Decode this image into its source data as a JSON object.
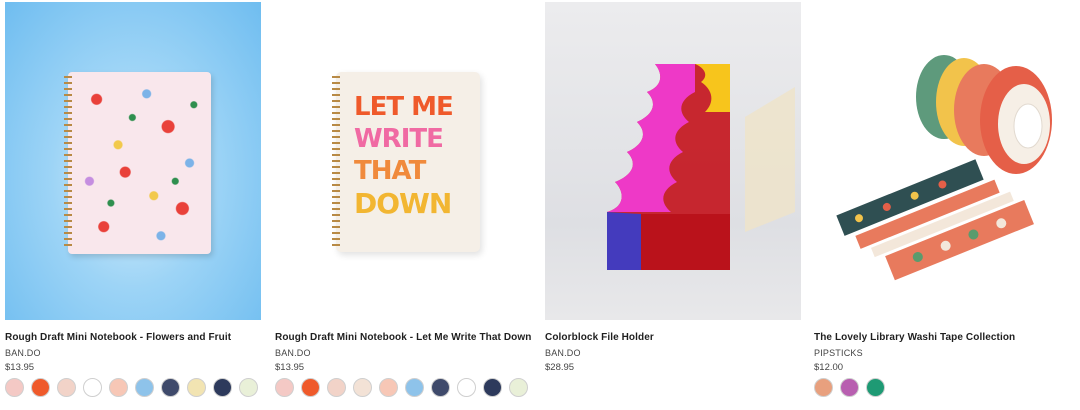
{
  "products": [
    {
      "title": "Rough Draft Mini Notebook - Flowers and Fruit",
      "brand": "BAN.DO",
      "price": "$13.95",
      "image_name": "notebook-flowers-fruit-image",
      "swatches": [
        "#f4c9c5",
        "#ef5a2b",
        "#f2d3c8",
        "#ffffff",
        "#f7c7b6",
        "#8ec3ea",
        "#3f4a6b",
        "#f2e4b2",
        "#2d3a5c",
        "#e9f0d8"
      ]
    },
    {
      "title": "Rough Draft Mini Notebook - Let Me Write That Down",
      "brand": "BAN.DO",
      "price": "$13.95",
      "image_name": "notebook-let-me-write-image",
      "cover_text": [
        "LET ME",
        "WRITE",
        "THAT",
        "DOWN"
      ],
      "swatches": [
        "#f4c9c5",
        "#ef5a2b",
        "#f2d3c8",
        "#f3e2d6",
        "#f7c7b6",
        "#8ec3ea",
        "#3f4a6b",
        "#ffffff",
        "#2d3a5c",
        "#e9f0d8"
      ]
    },
    {
      "title": "Colorblock File Holder",
      "brand": "BAN.DO",
      "price": "$28.95",
      "image_name": "colorblock-file-holder-image",
      "swatches": []
    },
    {
      "title": "The Lovely Library Washi Tape Collection",
      "brand": "PIPSTICKS",
      "price": "$12.00",
      "image_name": "washi-tape-collection-image",
      "swatches": [
        "#e8a07e",
        "#b85fb0",
        "#1e9a74"
      ]
    }
  ]
}
